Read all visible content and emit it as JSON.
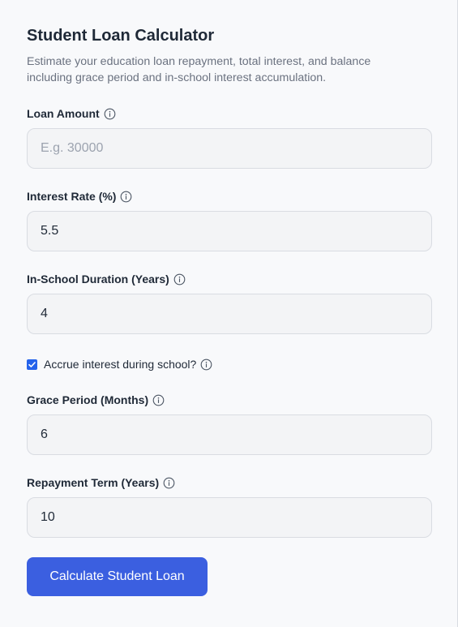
{
  "calculator": {
    "title": "Student Loan Calculator",
    "description": "Estimate your education loan repayment, total interest, and balance including grace period and in-school interest accumulation."
  },
  "fields": {
    "loan_amount": {
      "label": "Loan Amount",
      "value": "",
      "placeholder": "E.g. 30000"
    },
    "interest_rate": {
      "label": "Interest Rate (%)",
      "value": "5.5"
    },
    "in_school_duration": {
      "label": "In-School Duration (Years)",
      "value": "4"
    },
    "accrue_interest": {
      "label": "Accrue interest during school?",
      "checked": true
    },
    "grace_period": {
      "label": "Grace Period (Months)",
      "value": "6"
    },
    "repayment_term": {
      "label": "Repayment Term (Years)",
      "value": "10"
    }
  },
  "actions": {
    "calculate_label": "Calculate Student Loan"
  },
  "colors": {
    "accent": "#3b5fe0",
    "checkbox": "#2563eb",
    "input_bg": "#f3f4f6",
    "input_border": "#d9dce2",
    "muted_text": "#6b7280",
    "placeholder": "#9ca3af"
  },
  "icons": {
    "info": "info-circle-icon",
    "check": "checkmark-icon"
  }
}
